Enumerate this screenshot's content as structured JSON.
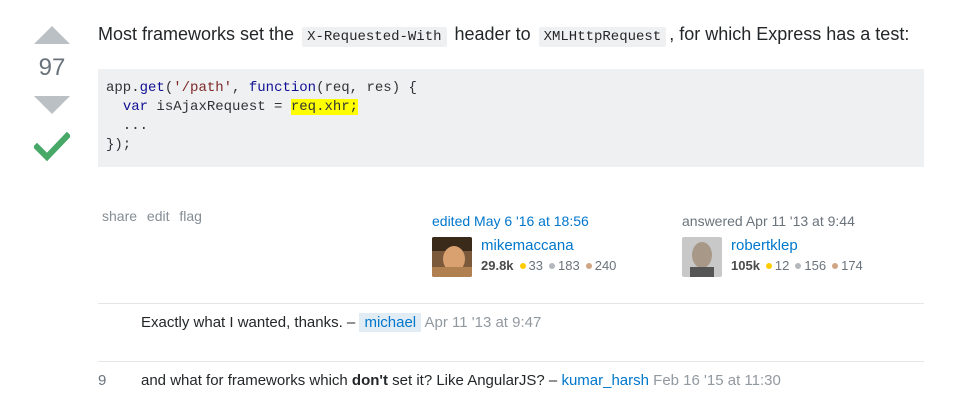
{
  "vote": {
    "count": "97"
  },
  "answer": {
    "text_before": "Most frameworks set the",
    "code1": "X-Requested-With",
    "text_mid": "header to",
    "code2": "XMLHttpRequest",
    "text_after": ", for which Express has a test:",
    "code_block": {
      "l1_a": "app.",
      "l1_fn": "get",
      "l1_b": "(",
      "l1_str": "'/path'",
      "l1_c": ", ",
      "l1_kw": "function",
      "l1_d": "(req, res) {",
      "l2_a": "  ",
      "l2_kw": "var",
      "l2_b": " isAjaxRequest = ",
      "l2_hl": "req.xhr;",
      "l3": "  ...",
      "l4": "});"
    }
  },
  "menu": {
    "share": "share",
    "edit": "edit",
    "flag": "flag"
  },
  "editor": {
    "action": "edited May 6 '16 at 18:56",
    "name": "mikemaccana",
    "rep": "29.8k",
    "gold": "33",
    "silver": "183",
    "bronze": "240"
  },
  "author": {
    "action": "answered Apr 11 '13 at 9:44",
    "name": "robertklep",
    "rep": "105k",
    "gold": "12",
    "silver": "156",
    "bronze": "174"
  },
  "comments": [
    {
      "score": "",
      "text": "Exactly what I wanted, thanks. –",
      "user": "michael",
      "date": "Apr 11 '13 at 9:47"
    },
    {
      "score": "9",
      "text_a": "and what for frameworks which",
      "bold": "don't",
      "text_b": "set it? Like AngularJS? –",
      "user": "kumar_harsh",
      "date": "Feb 16 '15 at 11:30"
    }
  ],
  "colors": {
    "accent": "#0077cc",
    "accepted": "#48a868",
    "highlight": "#ffff00"
  }
}
